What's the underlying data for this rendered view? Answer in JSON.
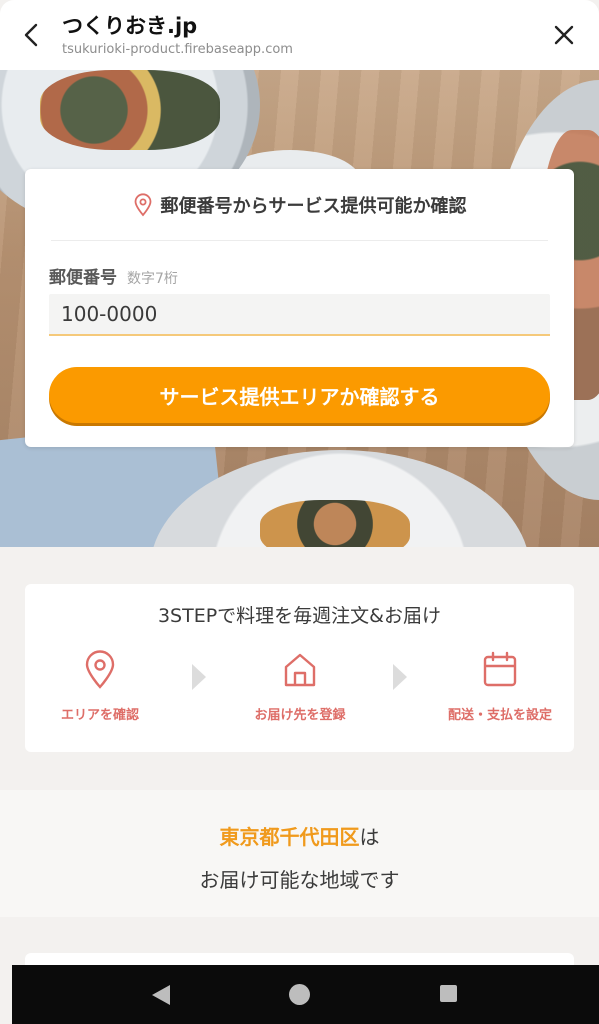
{
  "browser": {
    "title": "つくりおき.jp",
    "url": "tsukurioki-product.firebaseapp.com",
    "back_icon": "chevron-left-icon",
    "close_icon": "close-icon"
  },
  "postal_check": {
    "heading": "郵便番号からサービス提供可能か確認",
    "heading_icon": "map-pin-icon",
    "field_label": "郵便番号",
    "field_hint": "数字7桁",
    "field_value": "100-0000",
    "button_label": "サービス提供エリアか確認する",
    "accent_color": "#fb9a00"
  },
  "steps": {
    "title": "3STEPで料理を毎週注文&お届け",
    "items": [
      {
        "label": "エリアを確認",
        "icon": "map-pin-icon"
      },
      {
        "label": "お届け先を登録",
        "icon": "home-icon"
      },
      {
        "label": "配送・支払を設定",
        "icon": "calendar-icon"
      }
    ],
    "icon_color": "#de6e68"
  },
  "result": {
    "area": "東京都千代田区",
    "suffix": "は",
    "line2": "お届け可能な地域です",
    "area_color": "#f09a1c"
  }
}
